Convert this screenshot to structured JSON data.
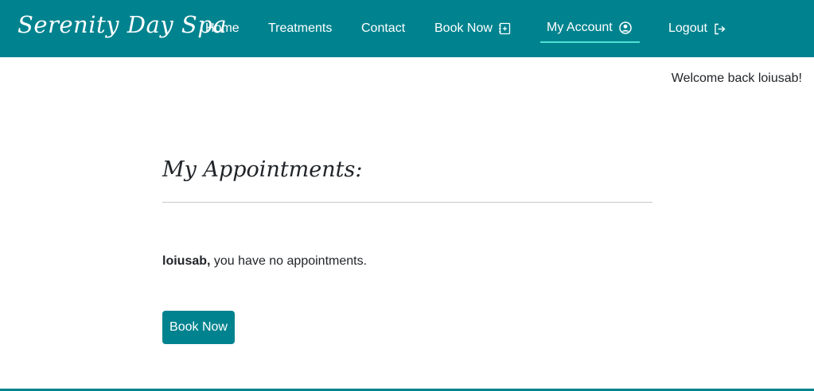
{
  "brand": "Serenity Day Spa",
  "nav": {
    "home": "Home",
    "treatments": "Treatments",
    "contact": "Contact",
    "book_now": "Book Now",
    "my_account": "My Account",
    "logout": "Logout"
  },
  "welcome": "Welcome back loiusab!",
  "main": {
    "title": "My Appointments:",
    "username": "loiusab,",
    "message": " you have no appointments.",
    "book_button": "Book Now"
  },
  "colors": {
    "primary": "#00838f",
    "active_underline": "#4fe3d3"
  },
  "icons": {
    "book_now": "add-calendar-icon",
    "my_account": "user-circle-icon",
    "logout": "logout-icon"
  }
}
